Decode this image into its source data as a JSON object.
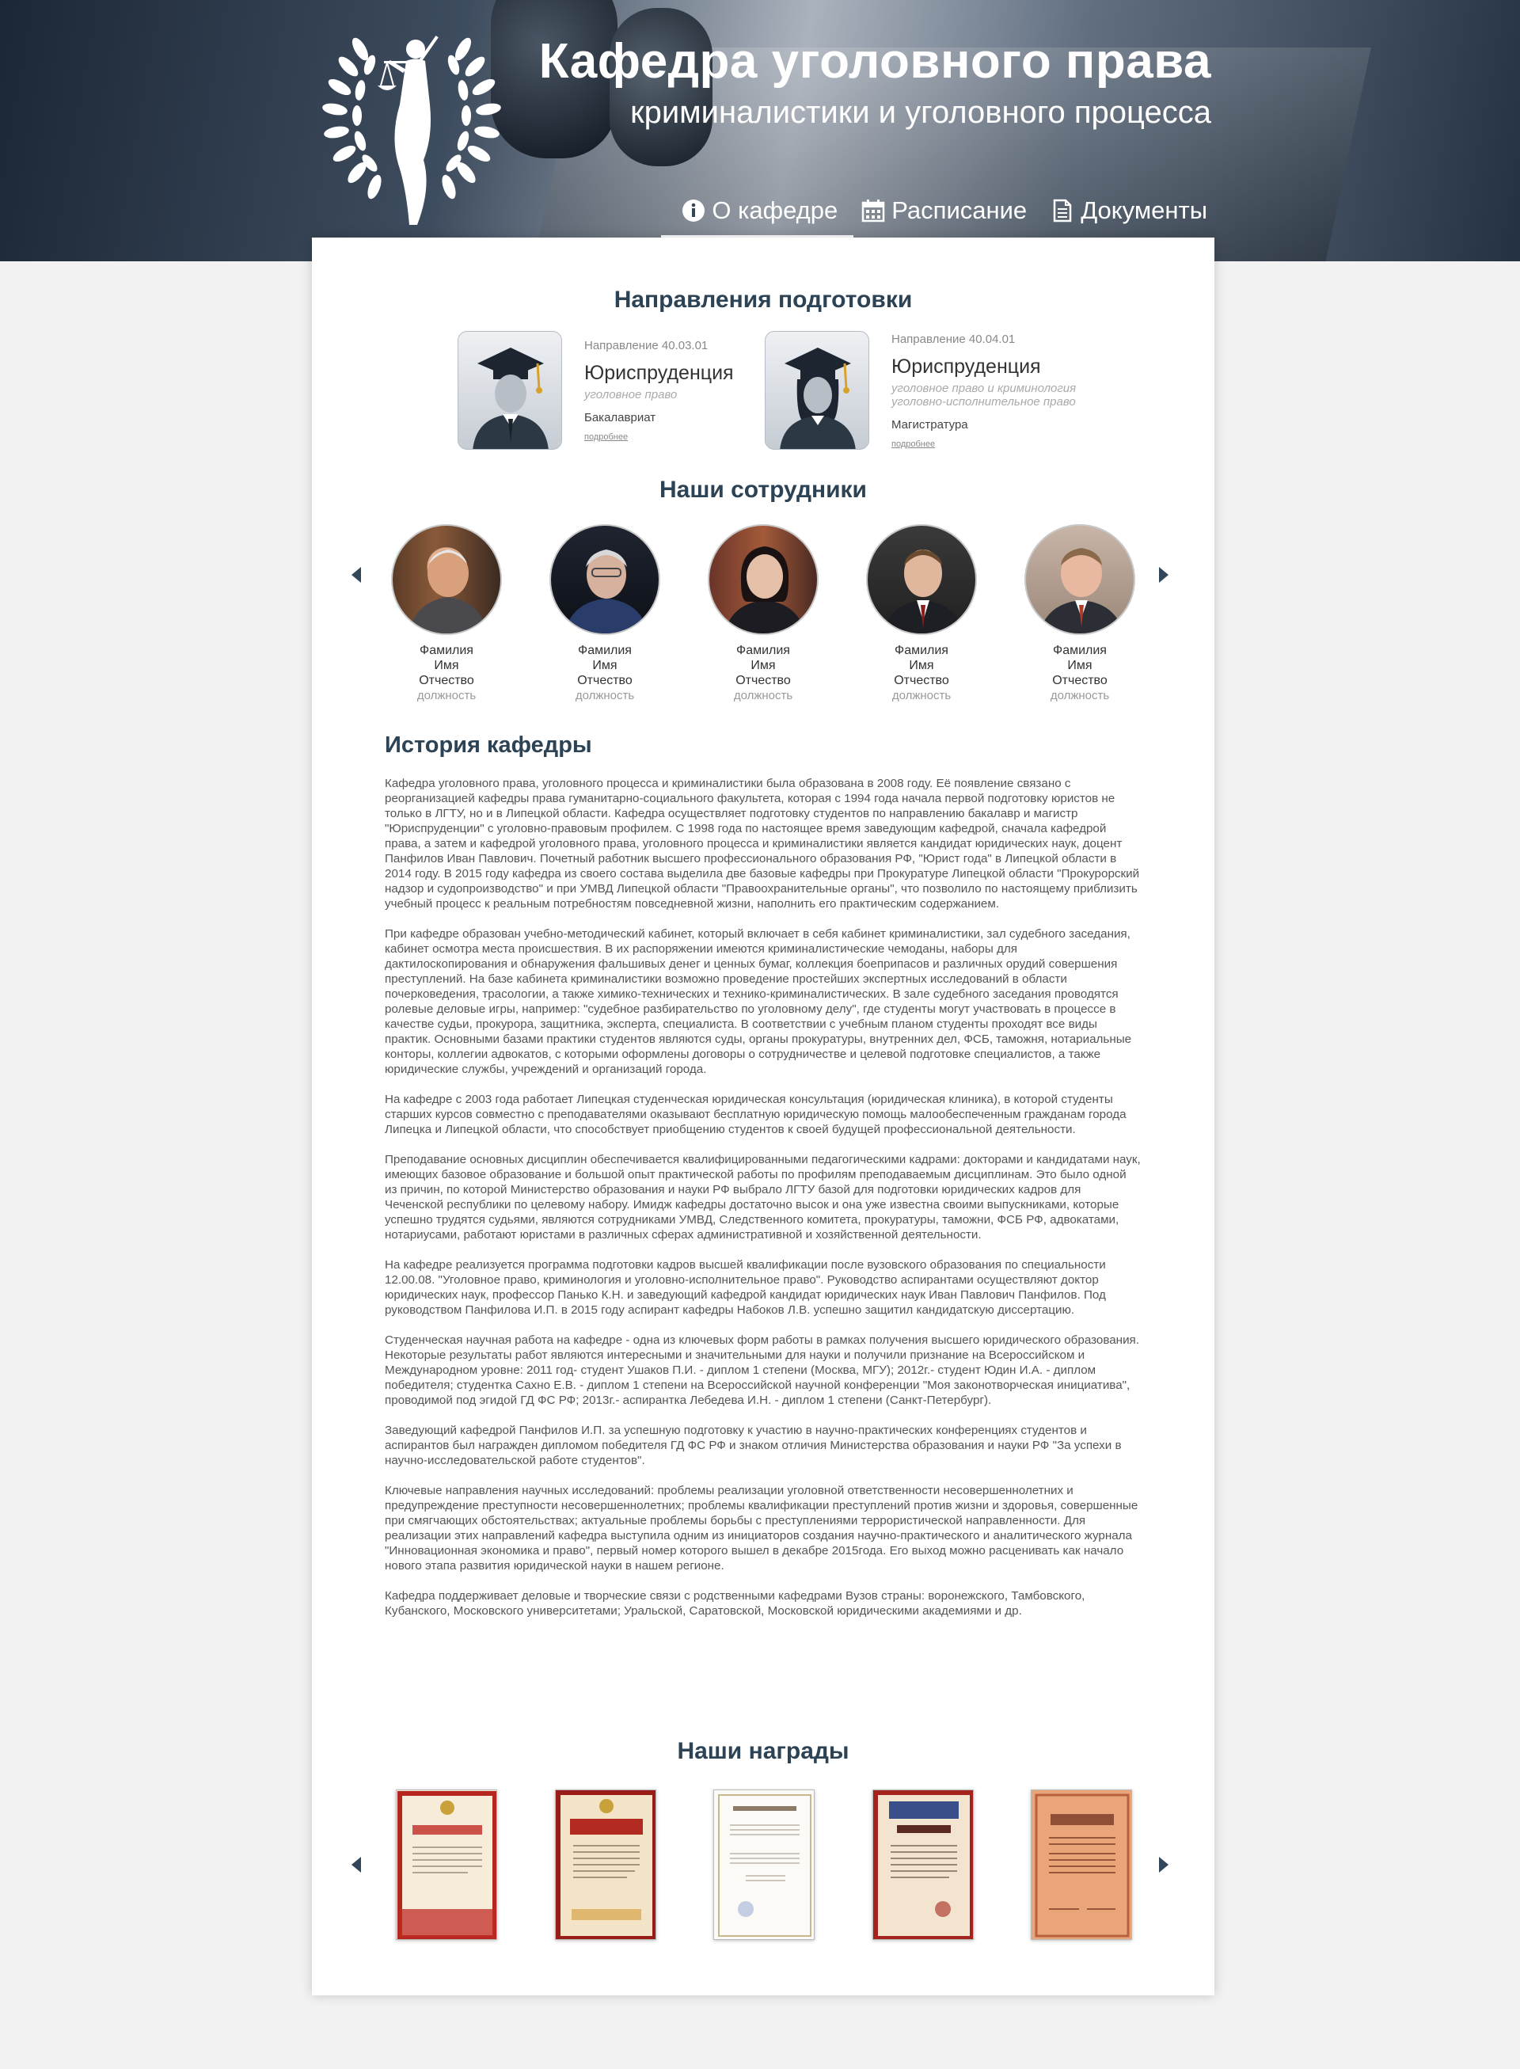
{
  "header": {
    "title_main": "Кафедра уголовного права",
    "title_sub": "криминалистики и уголовного процесса",
    "nav": [
      {
        "label": "О кафедре",
        "icon": "info-icon",
        "active": true
      },
      {
        "label": "Расписание",
        "icon": "calendar-icon",
        "active": false
      },
      {
        "label": "Документы",
        "icon": "document-icon",
        "active": false
      }
    ]
  },
  "programs": {
    "title": "Направления подготовки",
    "items": [
      {
        "code": "Направление 40.03.01",
        "name": "Юриспруденция",
        "desc_1": "уголовное право",
        "desc_2": "",
        "level": "Бакалавриат",
        "more": "подробнее"
      },
      {
        "code": "Направление 40.04.01",
        "name": "Юриспруденция",
        "desc_1": "уголовное право и криминология",
        "desc_2": "уголовно-исполнительное право",
        "level": "Магистратура",
        "more": "подробнее"
      }
    ]
  },
  "staff": {
    "title": "Наши сотрудники",
    "people": [
      {
        "last": "Фамилия",
        "first": "Имя",
        "middle": "Отчество",
        "role": "должность"
      },
      {
        "last": "Фамилия",
        "first": "Имя",
        "middle": "Отчество",
        "role": "должность"
      },
      {
        "last": "Фамилия",
        "first": "Имя",
        "middle": "Отчество",
        "role": "должность"
      },
      {
        "last": "Фамилия",
        "first": "Имя",
        "middle": "Отчество",
        "role": "должность"
      },
      {
        "last": "Фамилия",
        "first": "Имя",
        "middle": "Отчество",
        "role": "должность"
      }
    ]
  },
  "history": {
    "title": "История кафедры",
    "paragraphs": [
      "Кафедра уголовного права, уголовного процесса и криминалистики была образована в 2008 году. Её появление связано с реорганизацией кафедры права гуманитарно-социального факультета, которая с 1994 года начала первой подготовку юристов не только в ЛГТУ, но и в Липецкой области. Кафедра осуществляет подготовку студентов по направлению бакалавр и магистр \"Юриспруденции\" с уголовно-правовым профилем. С 1998 года по настоящее время заведующим кафедрой, сначала кафедрой права, а затем и кафедрой уголовного права, уголовного процесса и криминалистики является кандидат юридических наук, доцент Панфилов Иван Павлович. Почетный работник высшего профессионального образования РФ, \"Юрист года\" в Липецкой области в 2014 году. В 2015 году кафедра из своего состава выделила две базовые кафедры при Прокуратуре Липецкой области \"Прокурорский надзор и судопроизводство\" и при УМВД Липецкой области \"Правоохранительные органы\", что позволило по настоящему приблизить учебный процесс к реальным потребностям повседневной жизни, наполнить его практическим содержанием.",
      "При кафедре образован учебно-методический кабинет, который включает в себя кабинет криминалистики, зал судебного заседания, кабинет осмотра места происшествия. В их распоряжении имеются криминалистические чемоданы, наборы для дактилоскопирования и обнаружения фальшивых денег и ценных бумаг, коллекция боеприпасов и различных орудий совершения преступлений. На базе кабинета криминалистики возможно проведение простейших экспертных исследований в области почерковедения, трасологии, а также химико-технических и технико-криминалистических. В зале судебного заседания проводятся ролевые деловые игры, например: \"судебное разбирательство по уголовному делу\", где студенты могут участвовать в процессе в качестве судьи, прокурора, защитника, эксперта, специалиста. В соответствии с учебным планом студенты проходят все виды практик. Основными базами практики студентов являются суды, органы прокуратуры, внутренних дел, ФСБ, таможня, нотариальные конторы, коллегии адвокатов, с которыми оформлены договоры о сотрудничестве и целевой подготовке специалистов, а также юридические службы, учреждений и организаций города.",
      "На кафедре с 2003 года работает Липецкая студенческая юридическая консультация (юридическая клиника), в которой студенты старших курсов совместно с преподавателями оказывают бесплатную юридическую помощь малообеспеченным гражданам города Липецка и Липецкой области, что способствует приобщению студентов к своей будущей профессиональной деятельности.",
      "Преподавание основных дисциплин обеспечивается квалифицированными педагогическими кадрами: докторами и кандидатами наук, имеющих базовое образование и большой опыт практической работы по профилям преподаваемым дисциплинам. Это было одной из причин, по которой Министерство образования и науки РФ выбрало ЛГТУ базой для подготовки юридических кадров для Чеченской республики по целевому набору. Имидж кафедры достаточно высок и она уже известна своими выпускниками, которые успешно трудятся судьями, являются сотрудниками УМВД, Следственного комитета, прокуратуры, таможни, ФСБ РФ, адвокатами, нотариусами, работают юристами в различных сферах административной и хозяйственной деятельности.",
      "На кафедре реализуется программа подготовки кадров высшей квалификации после вузовского образования по специальности 12.00.08. \"Уголовное право, криминология и уголовно-исполнительное право\". Руководство аспирантами осуществляют доктор юридических наук, профессор Панько К.Н. и заведующий кафедрой кандидат юридических наук Иван Павлович Панфилов. Под руководством Панфилова И.П. в 2015 году аспирант кафедры Набоков Л.В. успешно защитил кандидатскую диссертацию.",
      "Студенческая научная работа на кафедре - одна из ключевых форм работы в рамках получения высшего юридического образования. Некоторые результаты работ являются интересными и значительными для науки и получили признание на Всероссийском и Международном уровне: 2011 год- студент Ушаков П.И. - диплом 1 степени (Москва, МГУ); 2012г.- студент Юдин И.А. - диплом победителя; студентка Сахно Е.В. - диплом 1 степени на Всероссийской научной конференции \"Моя законотворческая инициатива\", проводимой под эгидой ГД ФС РФ; 2013г.- аспирантка Лебедева И.Н. - диплом 1 степени (Санкт-Петербург).",
      "Заведующий кафедрой Панфилов И.П. за успешную подготовку к участию в научно-практических конференциях студентов и аспирантов был награжден дипломом победителя ГД ФС РФ и знаком отличия Министерства образования и науки РФ \"За успехи в научно-исследовательской работе студентов\".",
      "Ключевые направления научных исследований: проблемы реализации уголовной ответственности несовершеннолетних и предупреждение преступности несовершеннолетних; проблемы квалификации преступлений против жизни и здоровья, совершенные при смягчающих обстоятельствах; актуальные проблемы борьбы с преступлениями террористической направленности. Для реализации этих направлений кафедра выступила одним из инициаторов создания научно-практического и аналитического журнала \"Инновационная экономика и право\", первый номер которого вышел в декабре 2015года. Его выход можно расценивать как начало нового этапа развития юридической науки в нашем регионе.",
      "Кафедра поддерживает деловые и творческие связи с родственными кафедрами Вузов страны: воронежского, Тамбовского, Кубанского, Московского университетами; Уральской, Саратовской, Московской юридическими академиями и др."
    ]
  },
  "awards": {
    "title": "Наши награды",
    "items": [
      "Благодарственное письмо",
      "Диплом",
      "Почетная грамота",
      "Диплом",
      "Диплом"
    ]
  },
  "colors": {
    "accent": "#2c4255",
    "arrow": "#33475b"
  }
}
